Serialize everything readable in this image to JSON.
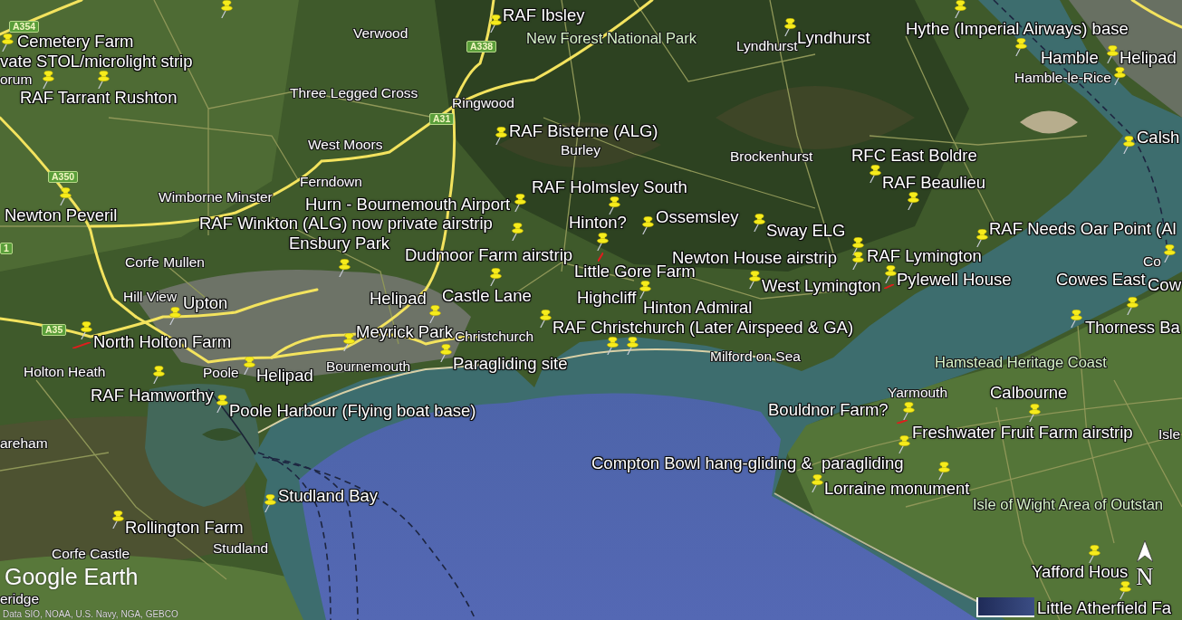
{
  "map": {
    "placemark_labels": [
      "RAF Ibsley",
      "Cemetery Farm",
      "Lyndhurst",
      "Hythe (Imperial Airways) base",
      "vate STOL/microlight strip",
      "Hamble",
      "Helipad",
      "RAF Tarrant Rushton",
      "RAF Bisterne (ALG)",
      "Calsh",
      "RFC East Boldre",
      "RAF Holmsley South",
      "RAF Beaulieu",
      "Newton Peveril",
      "Hurn - Bournemouth Airport",
      "RAF Winkton (ALG) now private airstrip",
      "Hinton?",
      "Ossemsley",
      "Ensbury Park",
      "Sway ELG",
      "RAF Needs Oar Point (Al",
      "Dudmoor Farm airstrip",
      "Little Gore Farm",
      "Newton House airstrip",
      "RAF Lymington",
      "Upton",
      "Helipad",
      "Castle Lane",
      "Highcliff",
      "Hinton Admiral",
      "West Lymington",
      "Pylewell House",
      "Cowes East",
      "Cow",
      "North Holton Farm",
      "Meyrick Park",
      "RAF Christchurch (Later Airspeed & GA)",
      "Thorness Ba",
      "Helipad",
      "Paragliding site",
      "RAF Hamworthy",
      "Calbourne",
      "Poole Harbour (Flying boat base)",
      "Bouldnor Farm?",
      "Freshwater Fruit Farm airstrip",
      "Compton Bowl hang-gliding &  paragliding",
      "Studland Bay",
      "Lorraine monument",
      "Rollington Farm",
      "Yafford Hous",
      "Little Atherfield Fa"
    ],
    "place_names": [
      {
        "name": "Verwood",
        "kind": "town"
      },
      {
        "name": "New Forest National Park",
        "kind": "area"
      },
      {
        "name": "Lyndhurst",
        "kind": "town"
      },
      {
        "name": "orum",
        "kind": "town"
      },
      {
        "name": "Hamble-le-Rice",
        "kind": "town"
      },
      {
        "name": "Three Legged Cross",
        "kind": "town"
      },
      {
        "name": "Ringwood",
        "kind": "town"
      },
      {
        "name": "West Moors",
        "kind": "town"
      },
      {
        "name": "Burley",
        "kind": "town"
      },
      {
        "name": "Brockenhurst",
        "kind": "town"
      },
      {
        "name": "Ferndown",
        "kind": "town"
      },
      {
        "name": "Wimborne Minster",
        "kind": "town"
      },
      {
        "name": "Corfe Mullen",
        "kind": "town"
      },
      {
        "name": "Co",
        "kind": "town"
      },
      {
        "name": "Hill View",
        "kind": "town"
      },
      {
        "name": "Christchurch",
        "kind": "town"
      },
      {
        "name": "Holton Heath",
        "kind": "town"
      },
      {
        "name": "Poole",
        "kind": "town"
      },
      {
        "name": "Bournemouth",
        "kind": "town"
      },
      {
        "name": "Milford on Sea",
        "kind": "town"
      },
      {
        "name": "Hamstead Heritage Coast",
        "kind": "area"
      },
      {
        "name": "Yarmouth",
        "kind": "town"
      },
      {
        "name": "areham",
        "kind": "town"
      },
      {
        "name": "Isle",
        "kind": "town"
      },
      {
        "name": "Isle of Wight Area of Outstan",
        "kind": "area"
      },
      {
        "name": "Corfe Castle",
        "kind": "town"
      },
      {
        "name": "Studland",
        "kind": "town"
      },
      {
        "name": "eridge",
        "kind": "town"
      }
    ],
    "road_shields": [
      "A354",
      "A338",
      "A31",
      "A350",
      "A35",
      "1"
    ],
    "compass": "N",
    "logo": "Google Earth",
    "attribution": "Data SIO, NOAA, U.S. Navy, NGA, GEBCO"
  }
}
